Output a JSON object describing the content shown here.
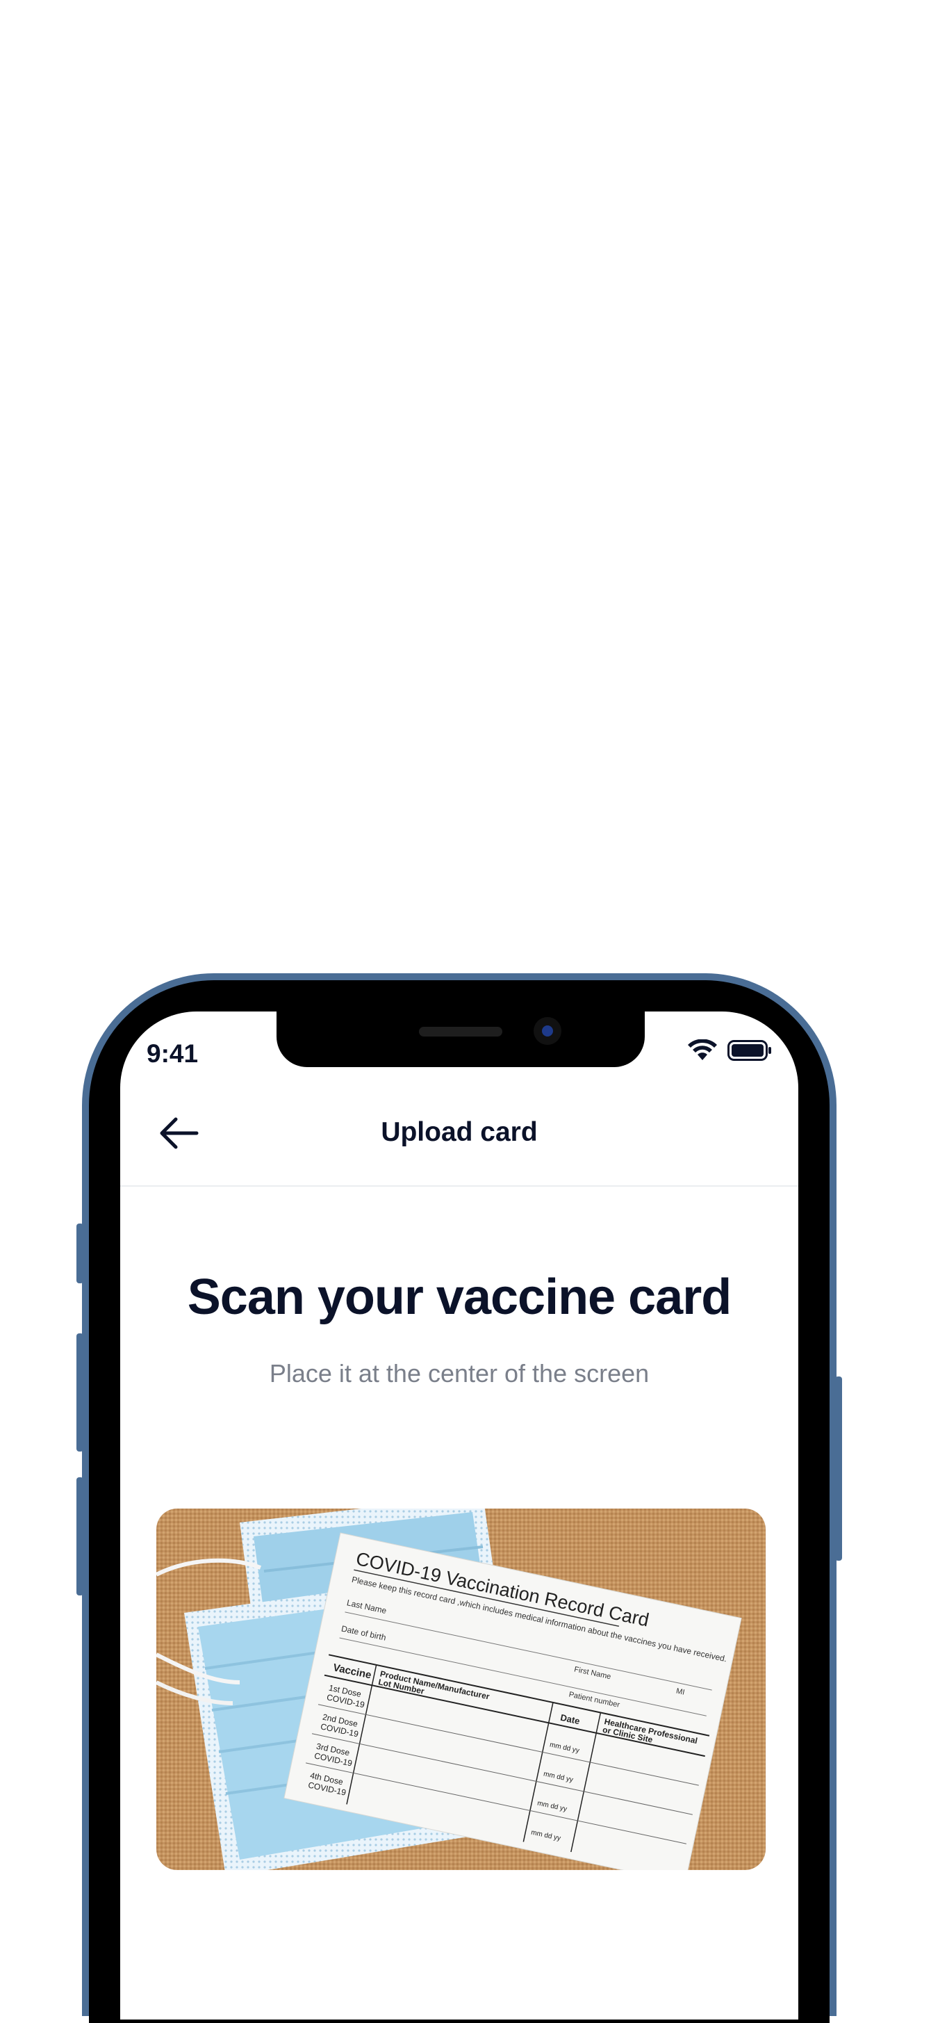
{
  "status_bar": {
    "time": "9:41",
    "wifi_icon": "wifi-icon",
    "battery_icon": "battery-icon"
  },
  "nav": {
    "back_icon": "arrow-left-icon",
    "title": "Upload card"
  },
  "main": {
    "heading": "Scan your vaccine card",
    "subtitle": "Place it at the center of the screen"
  },
  "card_photo": {
    "title": "COVID-19 Vaccination Record Card",
    "intro": "Please keep this record card ,which includes medical information about the vaccines you have received.",
    "last_name": "Last Name",
    "first_name": "First Name",
    "mi": "MI",
    "date_of_birth": "Date of birth",
    "patient_number": "Patient number",
    "col_vaccine": "Vaccine",
    "col_product": "Product Name/Manufacturer",
    "col_lot": "Lot Number",
    "col_date": "Date",
    "col_site_1": "Healthcare Professional",
    "col_site_2": "or Clinic Site",
    "doses": [
      {
        "dose": "1st Dose",
        "name": "COVID-19"
      },
      {
        "dose": "2nd Dose",
        "name": "COVID-19"
      },
      {
        "dose": "3rd Dose",
        "name": "COVID-19"
      },
      {
        "dose": "4th Dose",
        "name": "COVID-19"
      }
    ],
    "date_format": "mm  dd  yy"
  }
}
